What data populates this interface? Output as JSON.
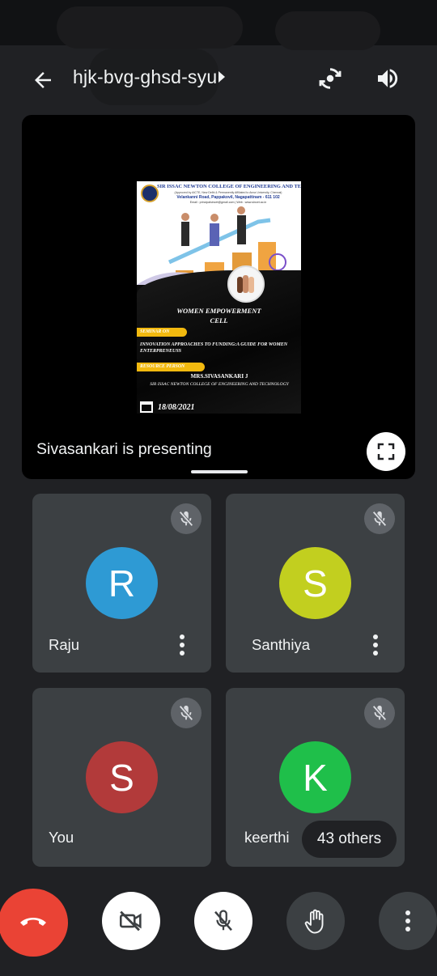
{
  "header": {
    "meeting_code": "hjk-bvg-ghsd-syu",
    "back_icon": "arrow-left-icon",
    "flip_camera_icon": "switch-camera-icon",
    "speaker_icon": "volume-icon"
  },
  "presentation": {
    "presenting_label": "Sivasankari is presenting",
    "fullscreen_icon": "fullscreen-icon",
    "poster": {
      "college": "SIR ISSAC NEWTON COLLEGE OF ENGINEERING AND TECHNOLOGY",
      "approval": "(Approved by AICTE, New Delhi & Permanently Affiliated to Anna University, Chennai)",
      "address": "Velankanni Road, Pappakovil, Nagapattinam - 611 102",
      "contact": "Email : principalsincet@gmail.com | Web : www.sincet.ac.in",
      "title_line1": "WOMEN EMPOWERMENT",
      "title_line2": "CELL",
      "seminar_tag": "SEMINAR ON",
      "topic": "INNOVATION APPROACHES TO FUNDING:A GUIDE FOR WOMEN ENTERPRENEUSS",
      "resource_tag": "RESOURCE PERSON",
      "speaker": "MRS.SIVASANKARI J",
      "speaker_org": "SIR ISSAC NEWTON COLLEGE OF ENGINEERING AND TECHNOLOGY",
      "date": "18/08/2021"
    }
  },
  "participants": [
    {
      "name": "Raju",
      "initial": "R",
      "color": "#2e9ad4",
      "muted": true
    },
    {
      "name": "Santhiya",
      "initial": "S",
      "color": "#c2cf1f",
      "muted": true
    },
    {
      "name": "You",
      "initial": "S",
      "color": "#b23a3a",
      "muted": true
    },
    {
      "name": "keerthi",
      "initial": "K",
      "color": "#1fbf4a",
      "muted": true
    }
  ],
  "others_label": "43 others",
  "controls": {
    "end_call_icon": "hang-up-icon",
    "camera_icon": "video-off-icon",
    "mic_icon": "mic-off-icon",
    "raise_hand_icon": "hand-icon",
    "more_icon": "more-vertical-icon",
    "colors": {
      "end_call": "#ea4335",
      "primary": "#ffffff",
      "secondary": "#3c4043"
    }
  }
}
